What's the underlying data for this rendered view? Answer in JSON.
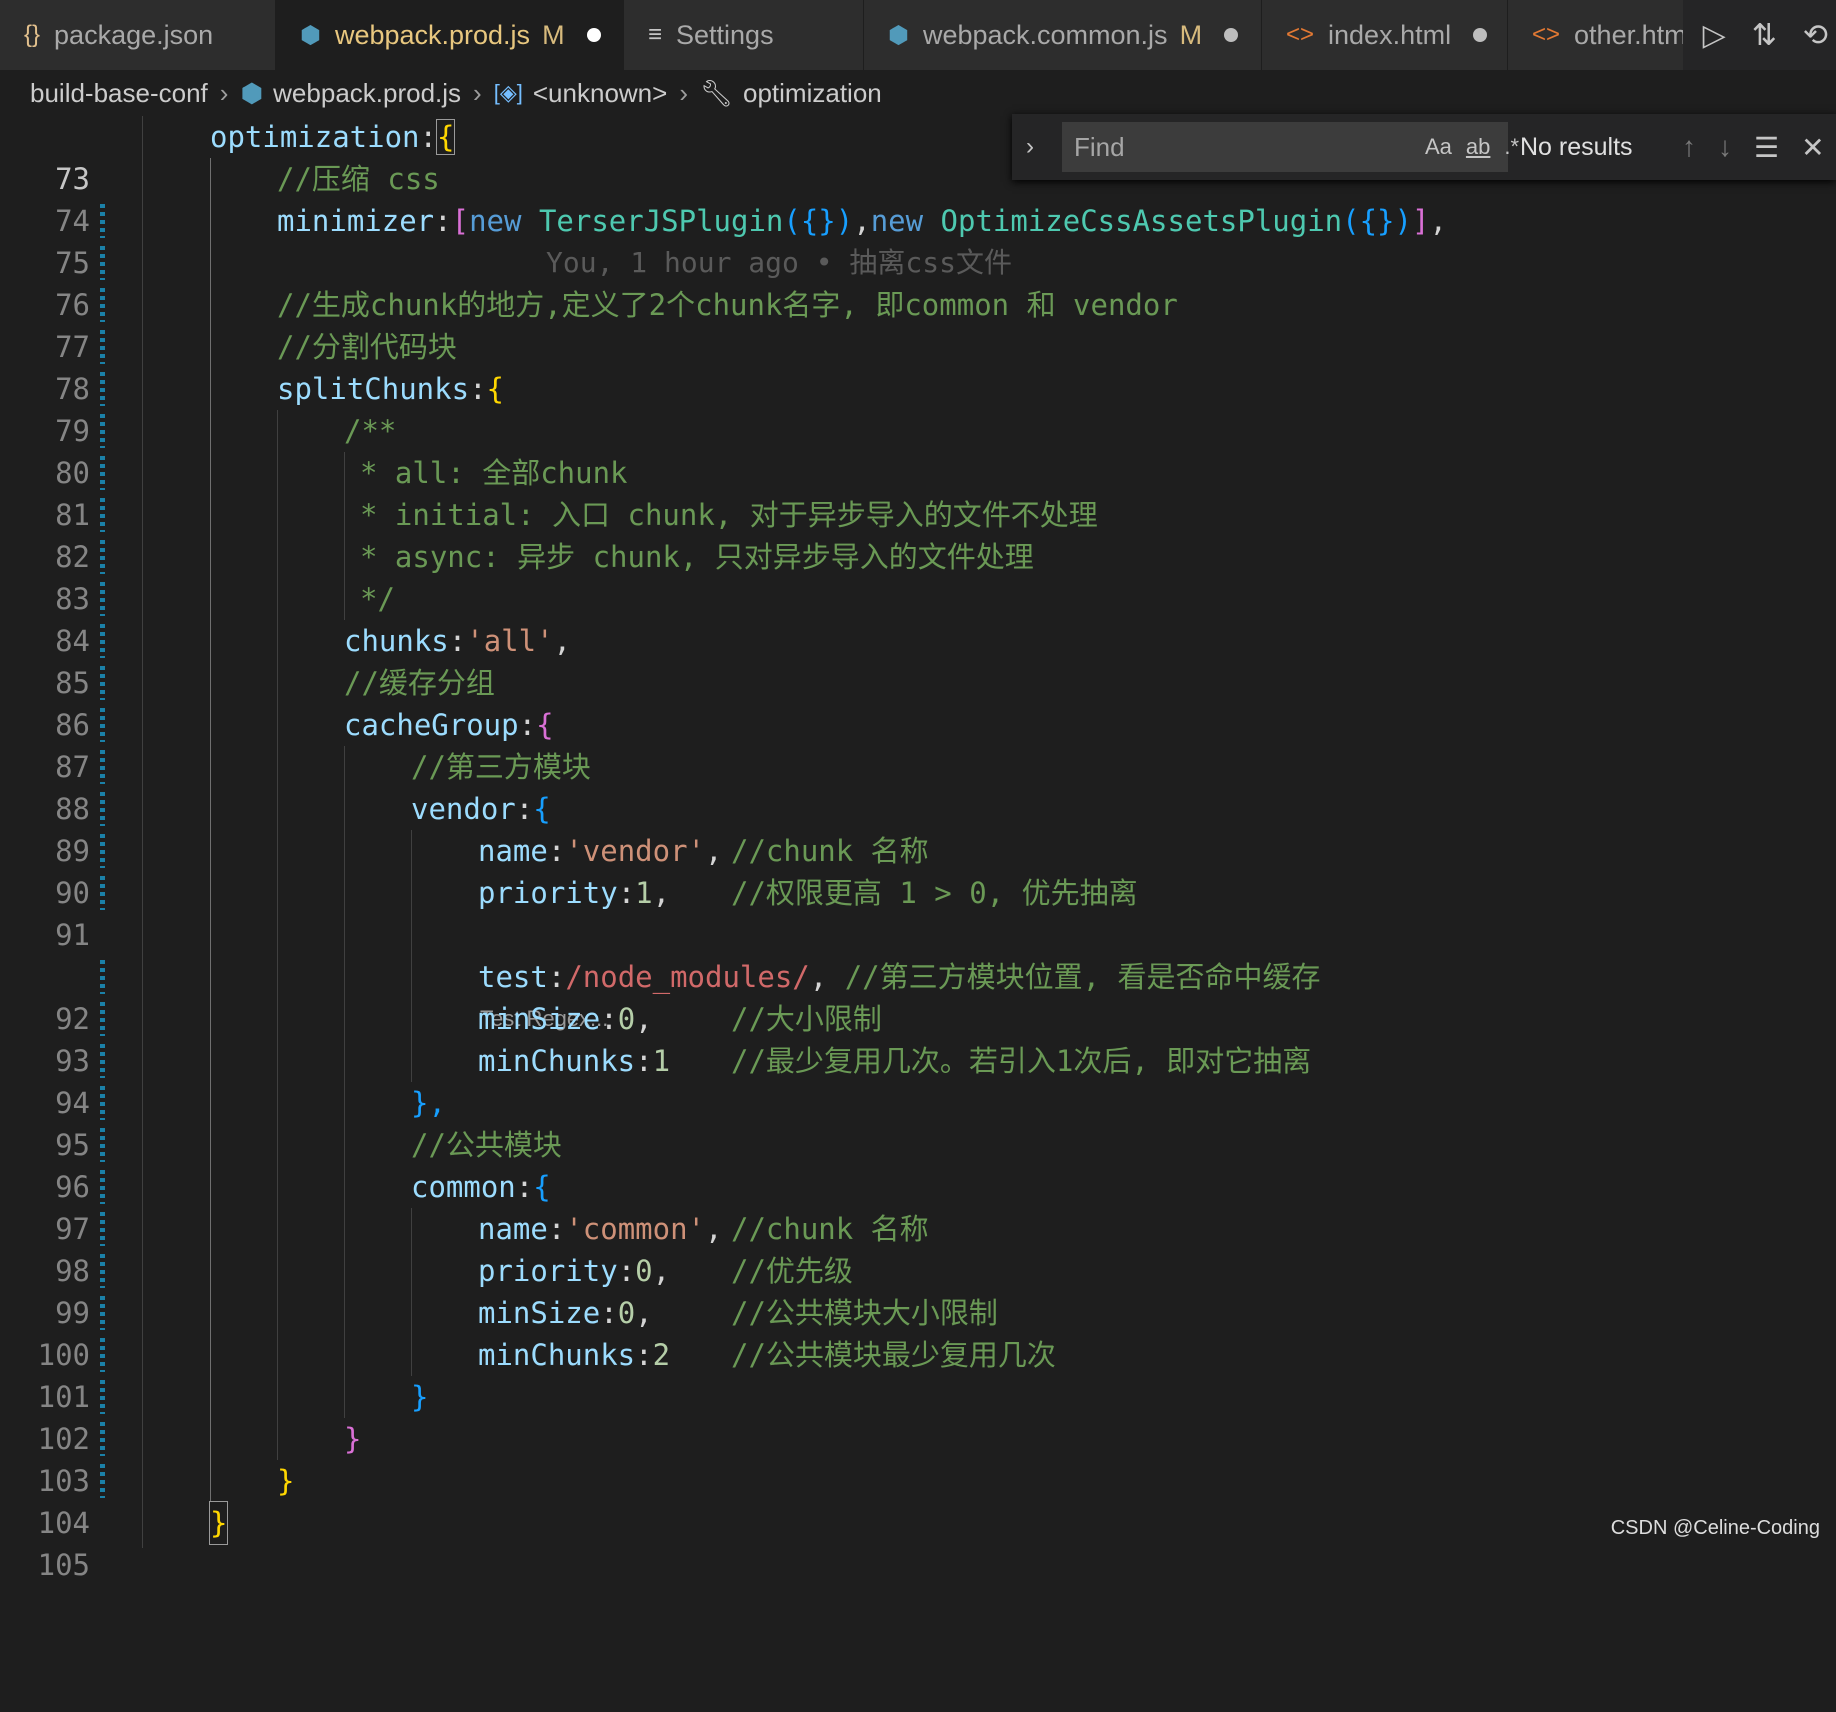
{
  "tabs": [
    {
      "icon": "{}",
      "label": "package.json",
      "modified": "",
      "dirty": false
    },
    {
      "icon": "⬢",
      "label": "webpack.prod.js",
      "modified": "M",
      "dirty": true
    },
    {
      "icon": "≡",
      "label": "Settings",
      "modified": "",
      "dirty": false
    },
    {
      "icon": "⬢",
      "label": "webpack.common.js",
      "modified": "M",
      "dirty": true
    },
    {
      "icon": "<>",
      "label": "index.html",
      "modified": "",
      "dirty": true
    },
    {
      "icon": "<>",
      "label": "other.html",
      "modified": "",
      "dirty": false
    }
  ],
  "breadcrumb": {
    "folder": "build-base-conf",
    "file": "webpack.prod.js",
    "symbol": "<unknown>",
    "property": "optimization"
  },
  "blame": "You, 1 hour ago • 抽离css文件",
  "codelens": "Test Regex...",
  "find": {
    "placeholder": "Find",
    "match_case": "Aa",
    "whole_word": "ab",
    "regex": ".*",
    "result": "No results"
  },
  "line_numbers": [
    "73",
    "74",
    "75",
    "76",
    "77",
    "78",
    "79",
    "80",
    "81",
    "82",
    "83",
    "84",
    "85",
    "86",
    "87",
    "88",
    "89",
    "90",
    "91",
    "92",
    "93",
    "94",
    "95",
    "96",
    "97",
    "98",
    "99",
    "100",
    "101",
    "102",
    "103",
    "104",
    "105"
  ],
  "code": {
    "l73": {
      "a": "optimization",
      "b": ":"
    },
    "l74": "//压缩 css",
    "l75": {
      "prop": "minimizer",
      "colon": ":",
      "open": "[",
      "new1": "new",
      "cls1": "TerserJSPlugin",
      "arg1": "({})",
      "comma1": ",",
      "new2": "new",
      "cls2": "OptimizeCssAssetsPlugin",
      "arg2": "({})",
      "close": "]",
      "end": ","
    },
    "l77": "//生成chunk的地方,定义了2个chunk名字, 即common 和 vendor",
    "l78": "//分割代码块",
    "l79": {
      "prop": "splitChunks",
      "colon": ":"
    },
    "l80": "/**",
    "l81": "* all: 全部chunk",
    "l82": "* initial: 入口 chunk, 对于异步导入的文件不处理",
    "l83": "* async: 异步 chunk, 只对异步导入的文件处理",
    "l84": "*/",
    "l85": {
      "prop": "chunks",
      "colon": ":",
      "val": "'all'",
      "end": ","
    },
    "l86": "//缓存分组",
    "l87": {
      "prop": "cacheGroup",
      "colon": ":"
    },
    "l88": "//第三方模块",
    "l89": {
      "prop": "vendor",
      "colon": ":"
    },
    "l90": {
      "prop": "name",
      "colon": ":",
      "val": "'vendor'",
      "end": ",",
      "comment": "//chunk 名称"
    },
    "l91": {
      "prop": "priority",
      "colon": ":",
      "val": "1",
      "end": ",",
      "comment": "//权限更高 1 > 0, 优先抽离"
    },
    "l92": {
      "prop": "test",
      "colon": ":",
      "val": "/node_modules/",
      "end": ",",
      "comment": "//第三方模块位置, 看是否命中缓存"
    },
    "l93": {
      "prop": "minSize",
      "colon": ":",
      "val": "0",
      "end": ",",
      "comment": "//大小限制"
    },
    "l94": {
      "prop": "minChunks",
      "colon": ":",
      "val": "1",
      "comment": "//最少复用几次。若引入1次后, 即对它抽离"
    },
    "l95": "},",
    "l96": "//公共模块",
    "l97": {
      "prop": "common",
      "colon": ":"
    },
    "l98": {
      "prop": "name",
      "colon": ":",
      "val": "'common'",
      "end": ",",
      "comment": "//chunk 名称"
    },
    "l99": {
      "prop": "priority",
      "colon": ":",
      "val": "0",
      "end": ",",
      "comment": "//优先级"
    },
    "l100": {
      "prop": "minSize",
      "colon": ":",
      "val": "0",
      "end": ",",
      "comment": "//公共模块大小限制"
    },
    "l101": {
      "prop": "minChunks",
      "colon": ":",
      "val": "2",
      "comment": "//公共模块最少复用几次"
    },
    "l102": "}",
    "l103": "}",
    "l104": "}",
    "l105": "}"
  },
  "brackets": {
    "open": "{"
  },
  "watermark": "CSDN @Celine-Coding"
}
